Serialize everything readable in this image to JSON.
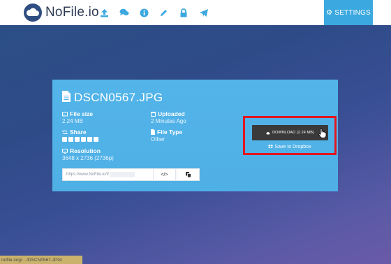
{
  "header": {
    "logo_text": "NoFile.io",
    "nav_icons": [
      "upload-icon",
      "chat-icon",
      "info-icon",
      "pencil-icon",
      "lock-icon",
      "paper-plane-icon"
    ],
    "settings_label": "SETTINGS",
    "accent_color": "#3ba8df"
  },
  "file": {
    "name": "DSCN0567.JPG",
    "size_label": "File size",
    "size_value": "2.24 MB",
    "uploaded_label": "Uploaded",
    "uploaded_value": "2 Minutes Ago",
    "share_label": "Share",
    "type_label": "File Type",
    "type_value": "Other",
    "resolution_label": "Resolution",
    "resolution_value": "3648 x 2736 (2736p)",
    "link_value": "https://www.NoFile.io/f/"
  },
  "actions": {
    "download_label": "DOWNLOAD (2.24 MB)",
    "dropbox_label": "Save to Dropbox",
    "copy_icon": "</>",
    "qr_icon": "copy-icon"
  },
  "statusbar": {
    "url": "nofile.io/g/···/DSCN0567.JPG/"
  }
}
